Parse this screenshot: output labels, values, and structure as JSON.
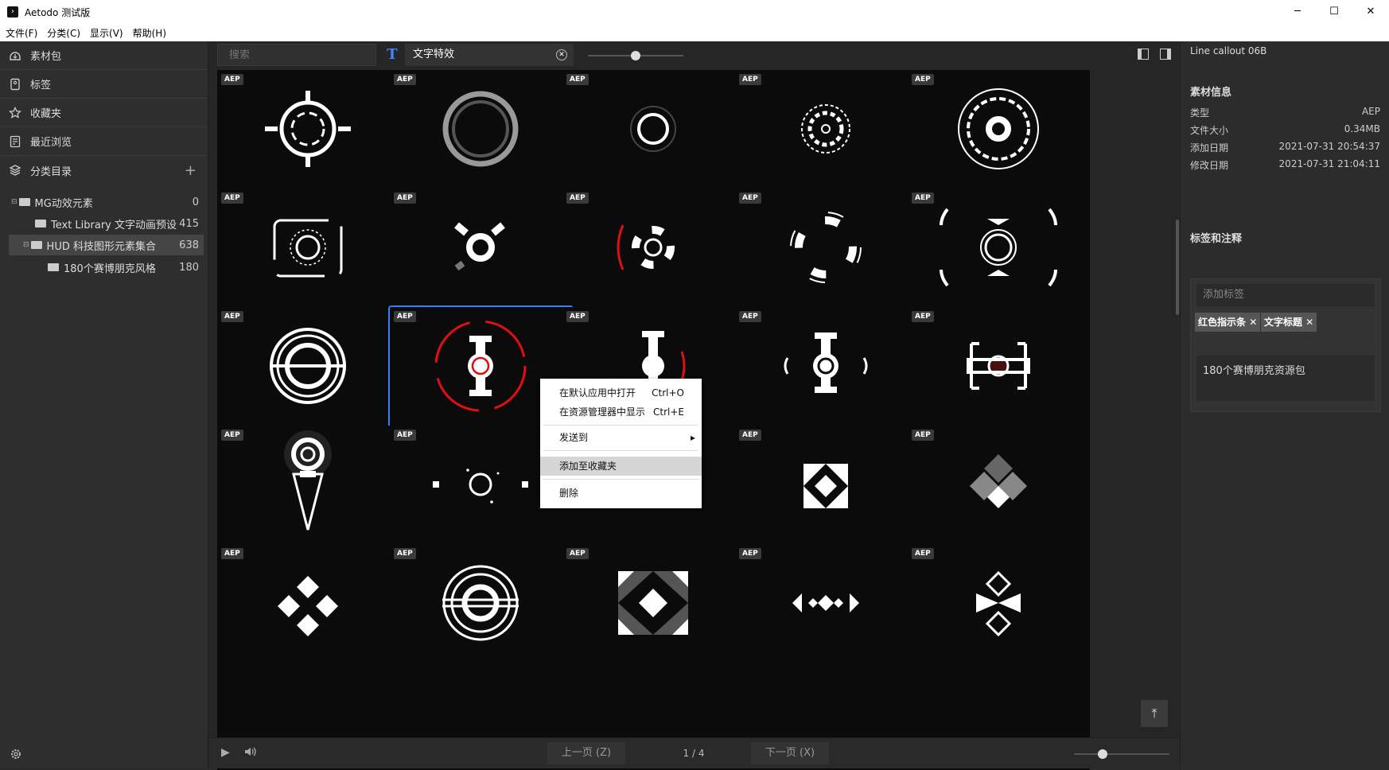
{
  "window": {
    "title": "Aetodo 测试版",
    "logo": "›"
  },
  "window_controls": {
    "minimize": "─",
    "maximize": "☐",
    "close": "✕"
  },
  "menu": [
    "文件(F)",
    "分类(C)",
    "显示(V)",
    "帮助(H)"
  ],
  "sidebar": {
    "nav": [
      {
        "label": "素材包",
        "icon": "package-icon"
      },
      {
        "label": "标签",
        "icon": "tag-icon"
      },
      {
        "label": "收藏夹",
        "icon": "star-icon"
      },
      {
        "label": "最近浏览",
        "icon": "history-icon"
      },
      {
        "label": "分类目录",
        "icon": "layers-icon"
      }
    ],
    "add": "+",
    "tree": [
      {
        "label": "MG动效元素",
        "count": "0"
      },
      {
        "label": "Text Library 文字动画预设",
        "count": "415"
      },
      {
        "label": "HUD 科技图形元素集合",
        "count": "638"
      },
      {
        "label": "180个赛博朋克风格",
        "count": "180"
      }
    ],
    "selected_tree_index": 2
  },
  "toolbar": {
    "search_placeholder": "搜索",
    "type_button": "T",
    "active_tag": "文字特效",
    "tag_close": "✕",
    "size_slider": 0.5
  },
  "grid": {
    "badge": "AEP",
    "selected_index": 11,
    "rows": 5,
    "cols": 5
  },
  "scroll_top": "⤒",
  "context_menu": {
    "items": [
      {
        "label": "在默认应用中打开",
        "shortcut": "Ctrl+O"
      },
      {
        "label": "在资源管理器中显示",
        "shortcut": "Ctrl+E"
      },
      {
        "label": "发送到",
        "shortcut": "▸"
      },
      {
        "label": "添加至收藏夹",
        "shortcut": ""
      },
      {
        "label": "删除",
        "shortcut": ""
      }
    ],
    "highlighted_index": 3
  },
  "pagination": {
    "prev": "上一页 (Z)",
    "page": "1 / 4",
    "next": "下一页 (X)"
  },
  "bottom_icons": {
    "play": "▶",
    "volume": "🔊"
  },
  "zoom_slider": 0.3,
  "details": {
    "name": "Line callout 06B",
    "info_title": "素材信息",
    "fields": [
      {
        "label": "类型",
        "value": "AEP"
      },
      {
        "label": "文件大小",
        "value": "0.34MB"
      },
      {
        "label": "添加日期",
        "value": "2021-07-31 20:54:37"
      },
      {
        "label": "修改日期",
        "value": "2021-07-31 21:04:11"
      }
    ],
    "tags_title": "标签和注释",
    "tag_input_placeholder": "添加标签",
    "tags": [
      "红色指示条",
      "文字标题"
    ],
    "tag_remove": "✕",
    "note": "180个赛博朋克资源包"
  },
  "colors": {
    "accent": "#3a7ef0",
    "red": "#e01010",
    "background": "#262626"
  }
}
